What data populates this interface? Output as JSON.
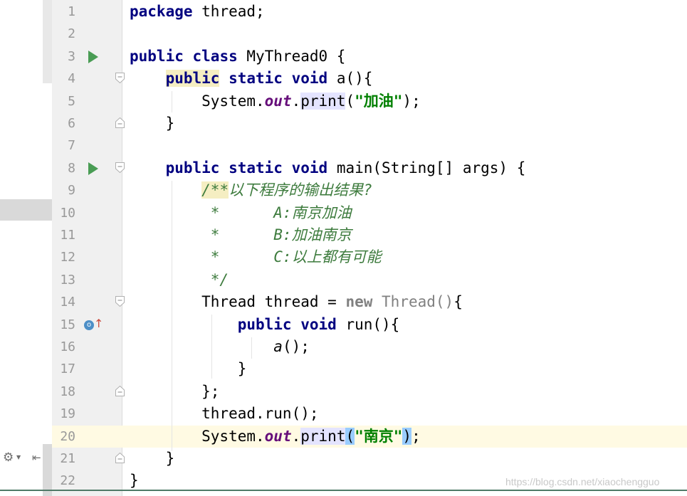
{
  "editor": {
    "lines": [
      {
        "n": "1",
        "tokens": [
          {
            "t": "package",
            "c": "kw"
          },
          {
            "t": " thread;"
          }
        ]
      },
      {
        "n": "2",
        "tokens": []
      },
      {
        "n": "3",
        "run": true,
        "tokens": [
          {
            "t": "public",
            "c": "kw"
          },
          {
            "t": " "
          },
          {
            "t": "class",
            "c": "kw"
          },
          {
            "t": " MyThread0 {"
          }
        ]
      },
      {
        "n": "4",
        "fold": "open",
        "tokens": [
          {
            "t": "    "
          },
          {
            "t": "public",
            "c": "kw hl-yellow"
          },
          {
            "t": " "
          },
          {
            "t": "static",
            "c": "kw"
          },
          {
            "t": " "
          },
          {
            "t": "void",
            "c": "kw"
          },
          {
            "t": " a(){"
          }
        ]
      },
      {
        "n": "5",
        "tokens": [
          {
            "t": "        System."
          },
          {
            "t": "out",
            "c": "field"
          },
          {
            "t": "."
          },
          {
            "t": "print",
            "c": "hl-lav"
          },
          {
            "t": "("
          },
          {
            "t": "\"加油\"",
            "c": "str"
          },
          {
            "t": ");"
          }
        ]
      },
      {
        "n": "6",
        "fold": "close",
        "tokens": [
          {
            "t": "    }"
          }
        ]
      },
      {
        "n": "7",
        "tokens": []
      },
      {
        "n": "8",
        "run": true,
        "fold": "open",
        "tokens": [
          {
            "t": "    "
          },
          {
            "t": "public",
            "c": "kw"
          },
          {
            "t": " "
          },
          {
            "t": "static",
            "c": "kw"
          },
          {
            "t": " "
          },
          {
            "t": "void",
            "c": "kw"
          },
          {
            "t": " main(String[] args) {"
          }
        ]
      },
      {
        "n": "9",
        "tokens": [
          {
            "t": "        "
          },
          {
            "t": "/**",
            "c": "cmt hl-yellow"
          },
          {
            "t": "以下程序的输出结果?",
            "c": "cmt"
          }
        ]
      },
      {
        "n": "10",
        "tokens": [
          {
            "t": "         *      A:南京加油",
            "c": "cmt"
          }
        ]
      },
      {
        "n": "11",
        "tokens": [
          {
            "t": "         *      B:加油南京",
            "c": "cmt"
          }
        ]
      },
      {
        "n": "12",
        "tokens": [
          {
            "t": "         *      C:以上都有可能",
            "c": "cmt"
          }
        ]
      },
      {
        "n": "13",
        "tokens": [
          {
            "t": "         */",
            "c": "cmt"
          }
        ]
      },
      {
        "n": "14",
        "fold": "open",
        "tokens": [
          {
            "t": "        Thread thread = "
          },
          {
            "t": "new",
            "c": "kwg"
          },
          {
            "t": " "
          },
          {
            "t": "Thread()",
            "c": "gray"
          },
          {
            "t": "{"
          }
        ]
      },
      {
        "n": "15",
        "override": true,
        "tokens": [
          {
            "t": "            "
          },
          {
            "t": "public",
            "c": "kw"
          },
          {
            "t": " "
          },
          {
            "t": "void",
            "c": "kw"
          },
          {
            "t": " run(){"
          }
        ]
      },
      {
        "n": "16",
        "tokens": [
          {
            "t": "                "
          },
          {
            "t": "a",
            "c": "ital"
          },
          {
            "t": "();"
          }
        ]
      },
      {
        "n": "17",
        "tokens": [
          {
            "t": "            }"
          }
        ]
      },
      {
        "n": "18",
        "fold": "close",
        "tokens": [
          {
            "t": "        };"
          }
        ]
      },
      {
        "n": "19",
        "tokens": [
          {
            "t": "        thread.run();"
          }
        ]
      },
      {
        "n": "20",
        "current": true,
        "tokens": [
          {
            "t": "        System."
          },
          {
            "t": "out",
            "c": "field"
          },
          {
            "t": "."
          },
          {
            "t": "print",
            "c": "hl-lav"
          },
          {
            "t": "(",
            "c": "hl-blue"
          },
          {
            "t": "\"南京\"",
            "c": "str"
          },
          {
            "t": ")",
            "c": "hl-blue"
          },
          {
            "t": ";"
          }
        ]
      },
      {
        "n": "21",
        "fold": "close",
        "tokens": [
          {
            "t": "    }"
          }
        ]
      },
      {
        "n": "22",
        "tokens": [
          {
            "t": "}"
          }
        ]
      }
    ]
  },
  "left_panel": {
    "settings_icon": "gear-icon",
    "pin_icon": "pin-left-icon"
  },
  "icons": {
    "run": "run-gutter-icon",
    "fold_open": "fold-open-icon",
    "fold_close": "fold-close-icon",
    "override": "override-method-icon"
  },
  "colors": {
    "keyword": "#000080",
    "string": "#008000",
    "comment": "#3d7b3d",
    "field": "#660e7a",
    "current_line": "#fffae3",
    "run_icon": "#499c54"
  },
  "watermark": "https://blog.csdn.net/xiaochengguo"
}
